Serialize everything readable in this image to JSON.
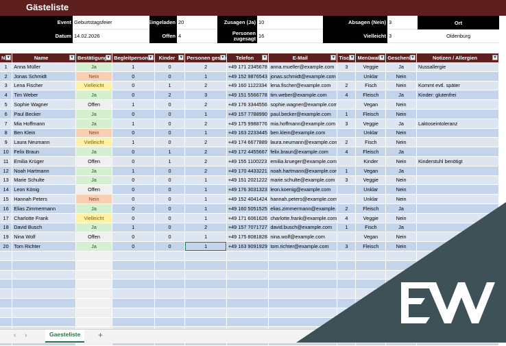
{
  "sheet_title": "Gästeliste",
  "info": {
    "event_label": "Event",
    "event_value": "Geburtstagsfeier",
    "datum_label": "Datum",
    "datum_value": "14.02.2026",
    "eingeladen_label": "Eingeladen",
    "eingeladen_value": "20",
    "offen_label": "Offen",
    "offen_value": "4",
    "zusagen_label": "Zusagen (Ja)",
    "zusagen_value": "10",
    "personen_label": "Personen zugesagt",
    "personen_value": "16",
    "absagen_label": "Absagen (Nein)",
    "absagen_value": "3",
    "vielleicht_label": "Vielleicht",
    "vielleicht_value": "3",
    "ort_label": "Ort",
    "ort_value": "Oldenburg"
  },
  "columns": [
    "Nr",
    "Name",
    "Bestätigung",
    "Begleitpersonen",
    "Kinder",
    "Personen gesamt",
    "Telefon",
    "E-Mail",
    "Tisch",
    "Menüwahl",
    "Geschenk",
    "Notizen / Allergien"
  ],
  "rows": [
    [
      "1",
      "Anna Müller",
      "Ja",
      "1",
      "0",
      "2",
      "+49 171 2345678",
      "anna.mueller@example.com",
      "3",
      "Veggie",
      "Ja",
      "Nussallergie"
    ],
    [
      "2",
      "Jonas Schmidt",
      "Nein",
      "0",
      "0",
      "1",
      "+49 152 9876543",
      "jonas.schmidt@example.com",
      "",
      "Unklar",
      "Nein",
      ""
    ],
    [
      "3",
      "Lena Fischer",
      "Vielleicht",
      "0",
      "1",
      "2",
      "+49 160 1122334",
      "lena.fischer@example.com",
      "2",
      "Fisch",
      "Nein",
      "Kommt evtl. später"
    ],
    [
      "4",
      "Tim Weber",
      "Ja",
      "0",
      "2",
      "3",
      "+49 151 5566778",
      "tim.weber@example.com",
      "4",
      "Fleisch",
      "Ja",
      "Kinder: glutenfrei"
    ],
    [
      "5",
      "Sophie Wagner",
      "Offen",
      "1",
      "0",
      "2",
      "+49 176 3344556",
      "sophie.wagner@example.com",
      "",
      "Vegan",
      "Nein",
      ""
    ],
    [
      "6",
      "Paul Becker",
      "Ja",
      "0",
      "0",
      "1",
      "+49 157 7788990",
      "paul.becker@example.com",
      "1",
      "Fleisch",
      "Nein",
      ""
    ],
    [
      "7",
      "Mia Hoffmann",
      "Ja",
      "1",
      "0",
      "2",
      "+49 175 9988776",
      "mia.hoffmann@example.com",
      "3",
      "Veggie",
      "Ja",
      "Laktoseintoleranz"
    ],
    [
      "8",
      "Ben Klein",
      "Nein",
      "0",
      "0",
      "1",
      "+49 163 2233445",
      "ben.klein@example.com",
      "",
      "Unklar",
      "Nein",
      ""
    ],
    [
      "9",
      "Laura Neumann",
      "Vielleicht",
      "1",
      "0",
      "2",
      "+49 174 6677889",
      "laura.neumann@example.com",
      "2",
      "Fisch",
      "Nein",
      ""
    ],
    [
      "10",
      "Felix Braun",
      "Ja",
      "0",
      "1",
      "2",
      "+49 172 4455667",
      "felix.braun@example.com",
      "4",
      "Fleisch",
      "Ja",
      ""
    ],
    [
      "11",
      "Emilia Krüger",
      "Offen",
      "0",
      "1",
      "2",
      "+49 155 1100223",
      "emilia.krueger@example.com",
      "",
      "Kinder",
      "Nein",
      "Kinderstuhl benötigt"
    ],
    [
      "12",
      "Noah Hartmann",
      "Ja",
      "1",
      "0",
      "2",
      "+49 170 4433221",
      "noah.hartmann@example.com",
      "1",
      "Vegan",
      "Ja",
      ""
    ],
    [
      "13",
      "Marie Schulte",
      "Ja",
      "0",
      "0",
      "1",
      "+49 151 2021222",
      "marie.schulte@example.com",
      "3",
      "Veggie",
      "Nein",
      ""
    ],
    [
      "14",
      "Leon König",
      "Offen",
      "0",
      "0",
      "1",
      "+49 176 3031323",
      "leon.koenig@example.com",
      "",
      "Unklar",
      "Nein",
      ""
    ],
    [
      "15",
      "Hannah Peters",
      "Nein",
      "0",
      "0",
      "1",
      "+49 152 4041424",
      "hannah.peters@example.com",
      "",
      "Unklar",
      "Nein",
      ""
    ],
    [
      "16",
      "Elias Zimmermann",
      "Ja",
      "0",
      "0",
      "1",
      "+49 160 5051525",
      "elias.zimmermann@example.com",
      "2",
      "Fleisch",
      "Ja",
      ""
    ],
    [
      "17",
      "Charlotte Frank",
      "Vielleicht",
      "0",
      "0",
      "1",
      "+49 171 6061626",
      "charlotte.frank@example.com",
      "4",
      "Veggie",
      "Nein",
      ""
    ],
    [
      "18",
      "David Busch",
      "Ja",
      "1",
      "0",
      "2",
      "+49 157 7071727",
      "david.busch@example.com",
      "1",
      "Fisch",
      "Ja",
      ""
    ],
    [
      "19",
      "Nina Wolf",
      "Offen",
      "0",
      "0",
      "1",
      "+49 175 8081828",
      "nina.wolf@example.com",
      "",
      "Vegan",
      "Nein",
      ""
    ],
    [
      "20",
      "Tom Richter",
      "Ja",
      "0",
      "0",
      "1",
      "+49 163 9091929",
      "tom.richter@example.com",
      "3",
      "Fleisch",
      "Nein",
      ""
    ]
  ],
  "empty_rows": 10,
  "sheet_tab": "Gaesteliste",
  "add_sheet": "+",
  "nav_prev": "‹",
  "nav_next": "›",
  "brand_overlay": {
    "logo": "EW logo",
    "color": "#3e5156"
  },
  "colors": {
    "header": "#5e1f1f",
    "row_odd": "#dde5f1",
    "row_even": "#c4d4ea",
    "ja": "#d6efd0",
    "nein": "#f8cfb3",
    "vielleicht": "#fff1a8",
    "offen": "#f0f0f0"
  }
}
